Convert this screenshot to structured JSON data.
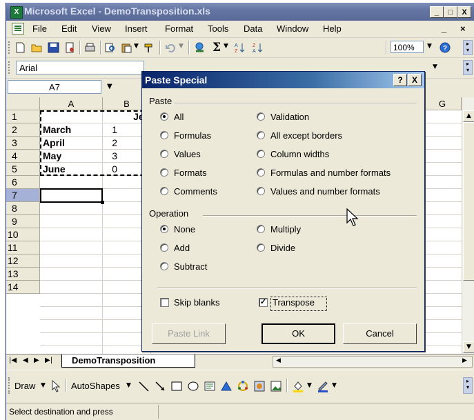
{
  "window": {
    "title": "Microsoft Excel - DemoTransposition.xls",
    "controls": [
      "_",
      "□",
      "X"
    ]
  },
  "menu": {
    "items": [
      "File",
      "Edit",
      "View",
      "Insert",
      "Format",
      "Tools",
      "Data",
      "Window",
      "Help"
    ],
    "right_controls": [
      "_",
      "×"
    ]
  },
  "toolbar": {
    "zoom": "100%",
    "font": "Arial"
  },
  "formula": {
    "name_box": "A7"
  },
  "grid": {
    "columns": [
      "A",
      "B",
      "G"
    ],
    "rows": [
      "1",
      "2",
      "3",
      "4",
      "5",
      "6",
      "7",
      "8",
      "9",
      "10",
      "11",
      "12",
      "13",
      "14"
    ],
    "col_b_header_value": "Jeff",
    "col_a_values": [
      "",
      "March",
      "April",
      "May",
      "June"
    ],
    "col_b_values": [
      "",
      "1",
      "2",
      "3",
      "0"
    ]
  },
  "sheet": {
    "tab_name": "DemoTransposition"
  },
  "drawing": {
    "draw_label": "Draw",
    "autoshapes_label": "AutoShapes"
  },
  "status": {
    "text": "Select destination and press"
  },
  "dialog": {
    "title": "Paste Special",
    "help_btn": "?",
    "close_btn": "X",
    "paste_group": "Paste",
    "paste_options_left": [
      "All",
      "Formulas",
      "Values",
      "Formats",
      "Comments"
    ],
    "paste_options_right": [
      "Validation",
      "All except borders",
      "Column widths",
      "Formulas and number formats",
      "Values and number formats"
    ],
    "paste_selected": "All",
    "operation_group": "Operation",
    "operation_left": [
      "None",
      "Add",
      "Subtract"
    ],
    "operation_right": [
      "Multiply",
      "Divide"
    ],
    "operation_selected": "None",
    "skip_blanks_label": "Skip blanks",
    "skip_blanks_checked": false,
    "transpose_label": "Transpose",
    "transpose_checked": true,
    "paste_link_btn": "Paste Link",
    "ok_btn": "OK",
    "cancel_btn": "Cancel"
  }
}
